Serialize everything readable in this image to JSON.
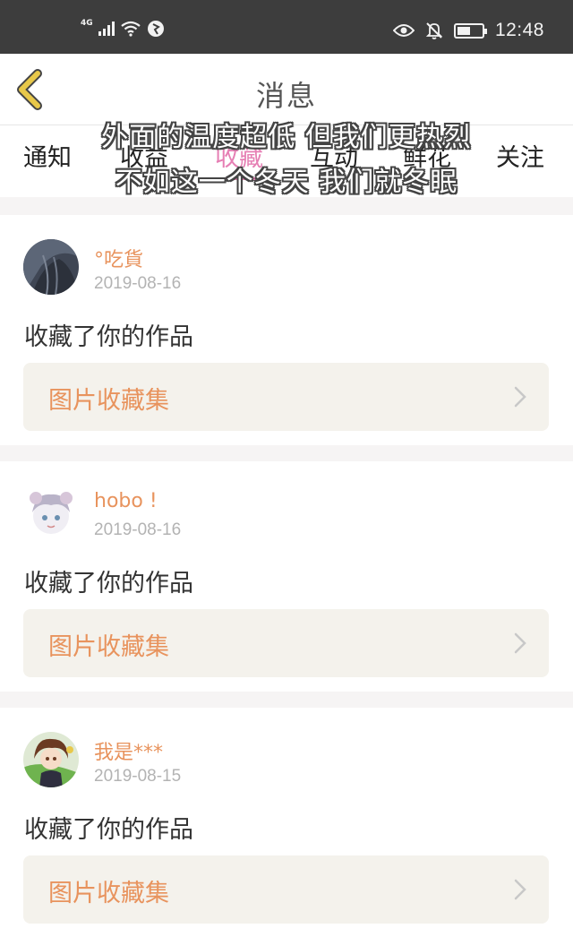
{
  "status_bar": {
    "network": "4G",
    "time": "12:48",
    "battery_level": 0.55,
    "icons": [
      "signal-icon",
      "wifi-icon",
      "browser-icon",
      "eye-icon",
      "bell-off-icon",
      "battery-icon"
    ]
  },
  "header": {
    "title": "消息",
    "back_icon": "chevron-left-icon"
  },
  "tabs": [
    {
      "label": "通知",
      "active": false
    },
    {
      "label": "收益",
      "active": false
    },
    {
      "label": "收藏",
      "active": true
    },
    {
      "label": "互动",
      "active": false
    },
    {
      "label": "鲜花",
      "active": false
    },
    {
      "label": "关注",
      "active": false
    }
  ],
  "overlay_caption": {
    "line1": "外面的温度超低 但我们更热烈",
    "line2": "不如这一个冬天 我们就冬眠"
  },
  "messages": [
    {
      "user": "°吃貨",
      "date": "2019-08-16",
      "text": "收藏了你的作品",
      "link_label": "图片收藏集"
    },
    {
      "user": "hobo !",
      "date": "2019-08-16",
      "text": "收藏了你的作品",
      "link_label": "图片收藏集"
    },
    {
      "user": "我是***",
      "date": "2019-08-15",
      "text": "收藏了你的作品",
      "link_label": "图片收藏集"
    }
  ],
  "colors": {
    "accent_pink": "#e67fb4",
    "accent_orange": "#e8935d",
    "back_arrow": "#e8c84a",
    "status_bar": "#3d3d3d",
    "feed_bg": "#f6f4f4"
  }
}
